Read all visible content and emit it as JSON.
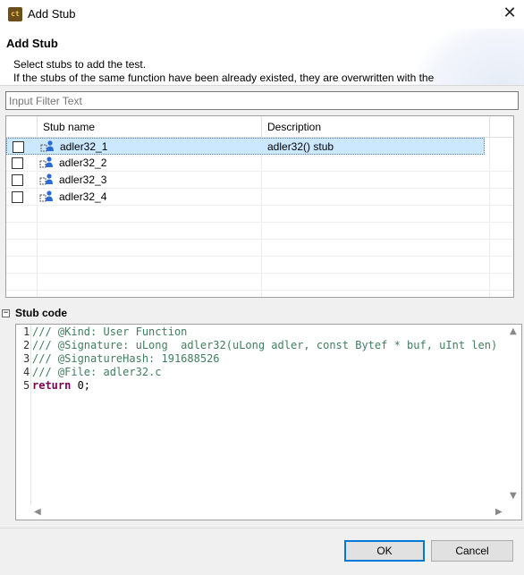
{
  "window": {
    "title": "Add Stub",
    "close_glyph": "✕",
    "icon": "ct"
  },
  "header": {
    "title": "Add Stub",
    "line1": "Select stubs to add the test.",
    "line2": "If the stubs of the same function have been already existed, they are overwritten with the"
  },
  "filter": {
    "placeholder": "Input Filter Text",
    "value": ""
  },
  "table": {
    "columns": [
      "Stub name",
      "Description"
    ],
    "rows": [
      {
        "name": "adler32_1",
        "description": "adler32() stub",
        "checked": false,
        "selected": true
      },
      {
        "name": "adler32_2",
        "description": "",
        "checked": false,
        "selected": false
      },
      {
        "name": "adler32_3",
        "description": "",
        "checked": false,
        "selected": false
      },
      {
        "name": "adler32_4",
        "description": "",
        "checked": false,
        "selected": false
      }
    ]
  },
  "stub_code": {
    "section_title": "Stub code",
    "toggle_glyph": "−",
    "lines": [
      {
        "num": "1",
        "text": "/// @Kind: User Function",
        "kind": "comment"
      },
      {
        "num": "2",
        "text": "/// @Signature: uLong  adler32(uLong adler, const Bytef * buf, uInt len)",
        "kind": "comment"
      },
      {
        "num": "3",
        "text": "/// @SignatureHash: 191688526",
        "kind": "comment"
      },
      {
        "num": "4",
        "text": "/// @File: adler32.c",
        "kind": "comment"
      },
      {
        "num": "5",
        "kw": "return",
        "rest": " 0;",
        "kind": "code"
      }
    ]
  },
  "buttons": {
    "ok": "OK",
    "cancel": "Cancel"
  },
  "icons": {
    "stub": "stub-person-icon",
    "close": "close-icon",
    "scroll_up": "▲",
    "scroll_down": "▼",
    "scroll_left": "◀",
    "scroll_right": "▶"
  }
}
